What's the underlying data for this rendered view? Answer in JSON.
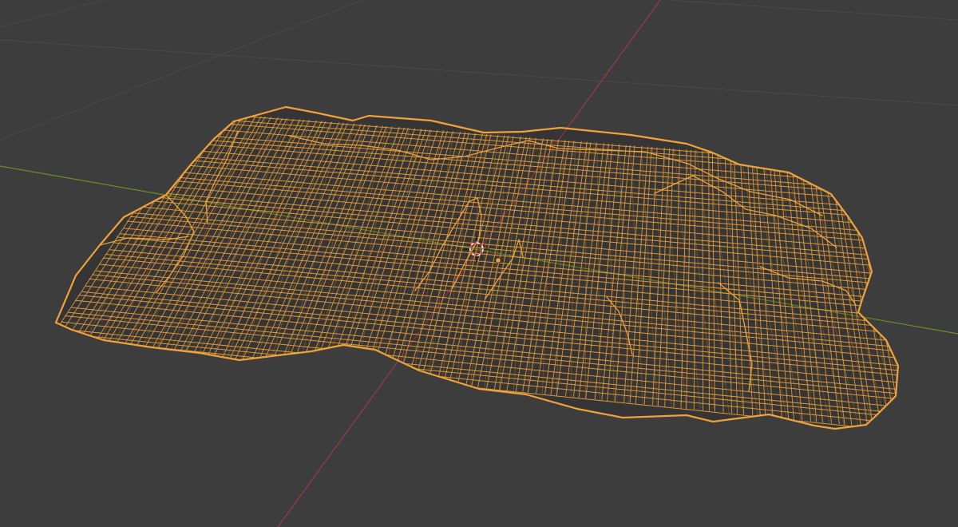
{
  "viewport": {
    "name": "3D Viewport",
    "shading": "wireframe"
  },
  "colors": {
    "background": "#3d3d3d",
    "grid_floor": "#4a4a4a",
    "x_axis": "#9c3b47",
    "y_axis": "#6a8d2a",
    "selection_wire": "#f0a23a",
    "origin": "#f0a23a",
    "cursor_red": "#e04a4a",
    "cursor_white": "#ffffff"
  },
  "object": {
    "type": "mesh",
    "state": "selected",
    "display": "wireframe"
  },
  "icons": {
    "cursor": "3d-cursor-icon",
    "origin": "object-origin-icon"
  }
}
